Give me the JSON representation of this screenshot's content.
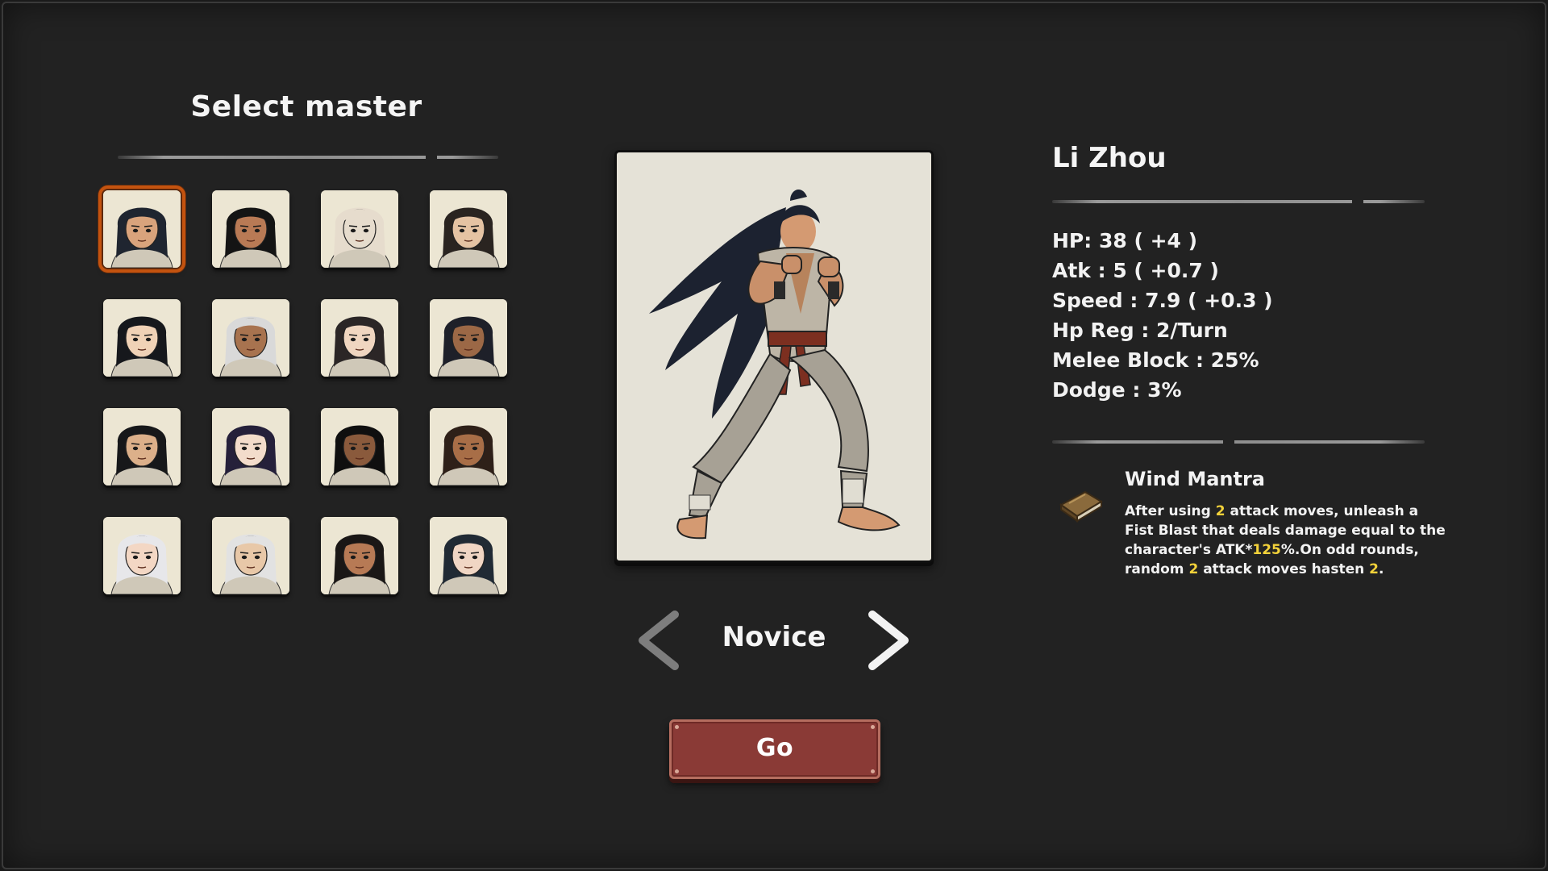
{
  "screen_title": "Select master",
  "portraits": [
    {
      "id": "li-zhou",
      "selected": true,
      "skin": "#d9a37c",
      "hair": "#1f2530"
    },
    {
      "id": "long-hair-woman",
      "selected": false,
      "skin": "#b97a55",
      "hair": "#141414"
    },
    {
      "id": "bald-elder",
      "selected": false,
      "skin": "#e6dccd",
      "hair": "#e6dccd"
    },
    {
      "id": "bun-woman",
      "selected": false,
      "skin": "#e5c3a3",
      "hair": "#2a2420"
    },
    {
      "id": "short-hair-youth",
      "selected": false,
      "skin": "#f0d2b6",
      "hair": "#16181c"
    },
    {
      "id": "grinning-elder",
      "selected": false,
      "skin": "#a8734f",
      "hair": "#d9d9d9"
    },
    {
      "id": "long-hair-youth",
      "selected": false,
      "skin": "#f0d6c0",
      "hair": "#2b2626"
    },
    {
      "id": "streaked-hair-man",
      "selected": false,
      "skin": "#9c6846",
      "hair": "#1e2029"
    },
    {
      "id": "scarred-brawler",
      "selected": false,
      "skin": "#dcb08a",
      "hair": "#17181a"
    },
    {
      "id": "violet-hair-woman",
      "selected": false,
      "skin": "#f3dccb",
      "hair": "#25203a"
    },
    {
      "id": "wild-hair-fighter",
      "selected": false,
      "skin": "#8a5a3c",
      "hair": "#0f0f0f"
    },
    {
      "id": "curly-hair-boy",
      "selected": false,
      "skin": "#a86e47",
      "hair": "#2e2018"
    },
    {
      "id": "headband-girl",
      "selected": false,
      "skin": "#f3d7c4",
      "hair": "#e7e7ea"
    },
    {
      "id": "white-hair-man",
      "selected": false,
      "skin": "#e8c8a8",
      "hair": "#e2e2e2"
    },
    {
      "id": "twin-buns-girl",
      "selected": false,
      "skin": "#b77a55",
      "hair": "#1a1716"
    },
    {
      "id": "dark-hair-woman",
      "selected": false,
      "skin": "#f0d6c4",
      "hair": "#202a34"
    }
  ],
  "rank": {
    "label": "Novice",
    "prev_icon": "chevron-left-icon",
    "next_icon": "chevron-right-icon"
  },
  "go_label": "Go",
  "character": {
    "name": "Li Zhou",
    "stats": [
      "HP: 38 ( +4 )",
      "Atk : 5 ( +0.7 )",
      "Speed : 7.9 ( +0.3 )",
      "Hp Reg : 2/Turn",
      "Melee Block : 25%",
      "Dodge : 3%"
    ],
    "skill": {
      "icon": "book-icon",
      "title": "Wind Mantra",
      "desc": {
        "p1": "After using ",
        "n1": "2",
        "p2": " attack moves, unleash a Fist Blast that deals damage equal to the character's ATK*",
        "n2": "125",
        "p3": "%.On odd rounds, random ",
        "n3": " 2",
        "p4": " attack moves hasten ",
        "n4": "2",
        "p5": "."
      }
    }
  },
  "colors": {
    "background": "#222222",
    "selected_outline": "#c4530f",
    "go_button": "#8a3a36",
    "highlight": "#f3d23a"
  }
}
